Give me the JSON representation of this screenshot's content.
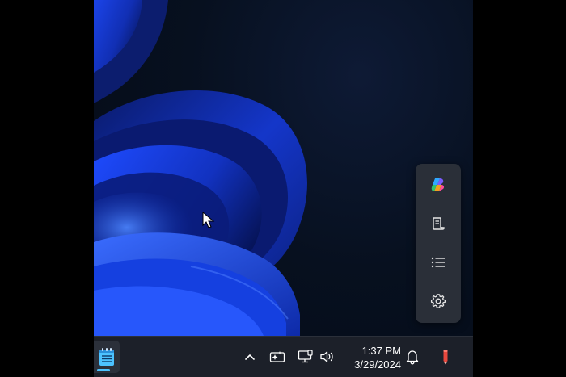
{
  "taskbar": {
    "app": {
      "icon": "notepad-icon",
      "pinned": true,
      "active": true
    },
    "tray": {
      "overflow_icon": "chevron-up-icon",
      "icons": [
        "copilot-key-icon",
        "network-icon",
        "volume-icon"
      ],
      "clock": {
        "time": "1:37 PM",
        "date": "3/29/2024"
      },
      "notification_icon": "bell-icon",
      "pen_icon": "pen-menu-icon"
    }
  },
  "side_panel": {
    "items": [
      {
        "name": "copilot",
        "icon": "copilot-icon"
      },
      {
        "name": "notes",
        "icon": "document-icon"
      },
      {
        "name": "list",
        "icon": "list-icon"
      },
      {
        "name": "settings",
        "icon": "gear-icon"
      }
    ]
  },
  "colors": {
    "wallpaper_bg": "#040a16",
    "wallpaper_bloom": "#1433c8",
    "taskbar_bg": "#1c2029",
    "panel_bg": "#2a2f38",
    "accent": "#4cc2ff",
    "pen_red": "#e8483e"
  }
}
